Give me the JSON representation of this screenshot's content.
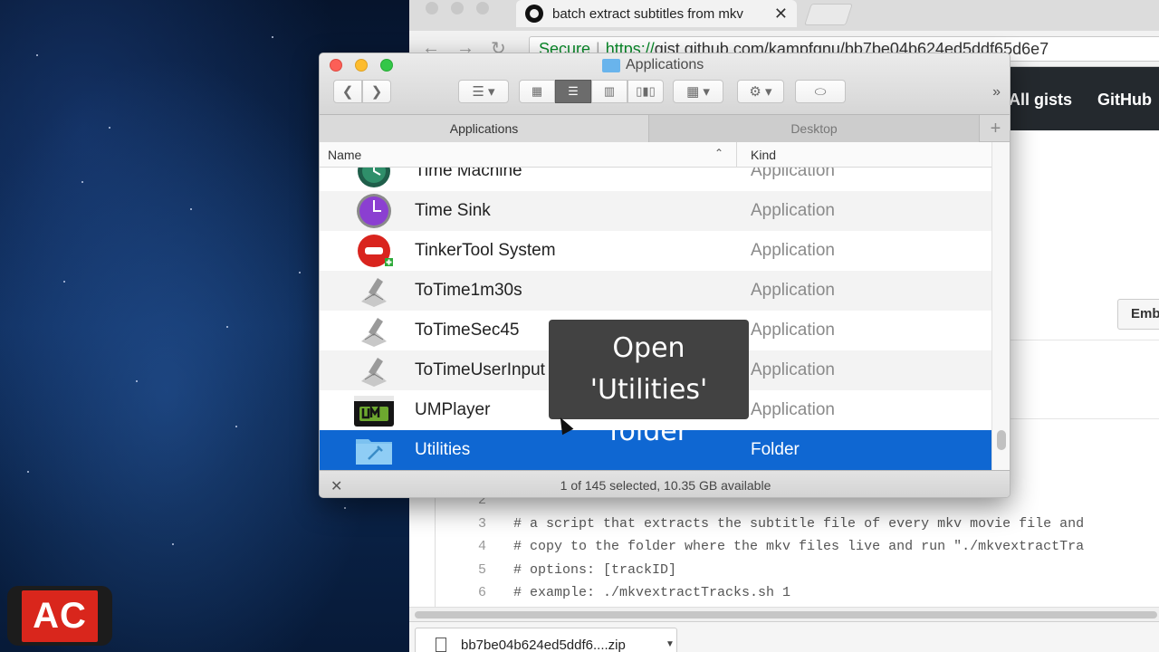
{
  "browser": {
    "tab_title": "batch extract subtitles from mkv",
    "tab_close": "✕",
    "secure_label": "Secure",
    "url_scheme": "https://",
    "url_host": "gist.github.com",
    "url_path": "/kampfgnu/bb7be04b624ed5ddf65d6e7",
    "header_links": [
      "All gists",
      "GitHub"
    ],
    "embed_label": "Emb",
    "code_lines": [
      {
        "num": "2",
        "text": ""
      },
      {
        "num": "3",
        "text": "# a script that extracts the subtitle file of every mkv movie file and"
      },
      {
        "num": "4",
        "text": "# copy to the folder where the mkv files live and run \"./mkvextractTra"
      },
      {
        "num": "5",
        "text": "# options: [trackID]"
      },
      {
        "num": "6",
        "text": "# example: ./mkvextractTracks.sh 1"
      }
    ],
    "download_name": "bb7be04b624ed5ddf6....zip"
  },
  "finder": {
    "window_title": "Applications",
    "tabs": [
      "Applications",
      "Desktop"
    ],
    "add_tab": "+",
    "col_name": "Name",
    "col_kind": "Kind",
    "rows": [
      {
        "name": "Time Machine",
        "kind": "Application",
        "icon": "time-machine-icon"
      },
      {
        "name": "Time Sink",
        "kind": "Application",
        "icon": "time-sink-icon"
      },
      {
        "name": "TinkerTool System",
        "kind": "Application",
        "icon": "tinkertool-icon"
      },
      {
        "name": "ToTime1m30s",
        "kind": "Application",
        "icon": "automator-app-icon"
      },
      {
        "name": "ToTimeSec45",
        "kind": "Application",
        "icon": "automator-app-icon"
      },
      {
        "name": "ToTimeUserInput",
        "kind": "Application",
        "icon": "automator-app-icon"
      },
      {
        "name": "UMPlayer",
        "kind": "Application",
        "icon": "umplayer-icon"
      },
      {
        "name": "Utilities",
        "kind": "Folder",
        "icon": "folder-icon"
      }
    ],
    "status": "1 of 145 selected, 10.35 GB available"
  },
  "overlay": {
    "line1": "Open",
    "line2": "'Utilities' folder"
  },
  "logo": "AC"
}
